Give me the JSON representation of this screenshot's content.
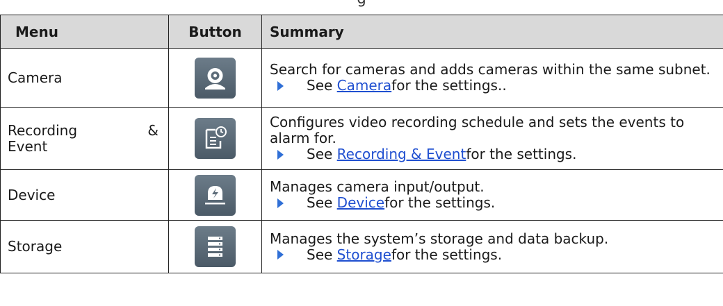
{
  "caption_fragment": "g",
  "table": {
    "headers": {
      "menu": "Menu",
      "button": "Button",
      "summary": "Summary"
    },
    "rows": [
      {
        "menu": "Camera",
        "icon": "camera-icon",
        "summary": "Search for cameras and adds cameras within the same subnet.",
        "see_prefix": "See ",
        "link": "Camera ",
        "see_suffix": "for the settings.."
      },
      {
        "menu_part1": "Recording",
        "menu_amp": "&",
        "menu_part2": "Event",
        "icon": "recording-event-icon",
        "summary": "Configures video recording schedule and sets the events to alarm for.",
        "see_prefix": "See ",
        "link": "Recording & Event ",
        "see_suffix": "for the settings."
      },
      {
        "menu": "Device",
        "icon": "device-icon",
        "summary": "Manages camera input/output.",
        "see_prefix": "See ",
        "link": "Device ",
        "see_suffix": "for the settings."
      },
      {
        "menu": "Storage",
        "icon": "storage-icon",
        "summary": "Manages the system’s storage and data backup.",
        "see_prefix": "See ",
        "link": "Storage ",
        "see_suffix": "for the settings."
      }
    ]
  },
  "colors": {
    "header_bg": "#d9d9d9",
    "icon_bg": "#5d6c79",
    "link": "#1f4fd0",
    "bullet": "#2f6fd6"
  }
}
